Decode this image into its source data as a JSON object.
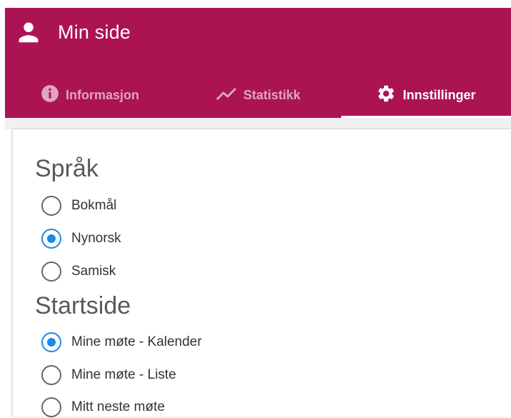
{
  "header": {
    "title": "Min side",
    "icon": "person-icon",
    "background": "#ab1352"
  },
  "tabs": [
    {
      "label": "Informasjon",
      "icon": "info-icon",
      "active": false
    },
    {
      "label": "Statistikk",
      "icon": "trending-up-icon",
      "active": false
    },
    {
      "label": "Innstillinger",
      "icon": "gear-icon",
      "active": true
    }
  ],
  "language": {
    "title": "Språk",
    "options": [
      {
        "label": "Bokmål",
        "checked": false
      },
      {
        "label": "Nynorsk",
        "checked": true
      },
      {
        "label": "Samisk",
        "checked": false
      }
    ]
  },
  "startpage": {
    "title": "Startside",
    "options": [
      {
        "label": "Mine møte - Kalender",
        "checked": true
      },
      {
        "label": "Mine møte - Liste",
        "checked": false
      },
      {
        "label": "Mitt neste møte",
        "checked": false
      }
    ]
  },
  "colors": {
    "accent": "#ab1352",
    "radio_selected": "#1e88e5"
  }
}
